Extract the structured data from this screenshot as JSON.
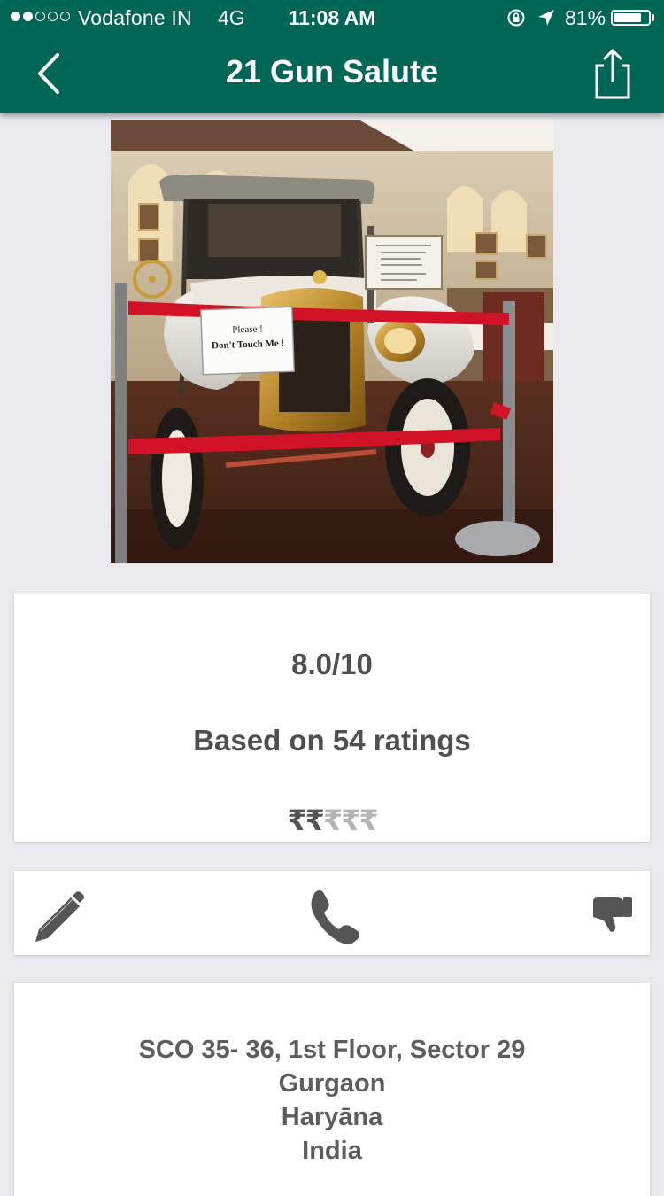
{
  "status_bar": {
    "carrier": "Vodafone IN",
    "network": "4G",
    "time": "11:08 AM",
    "battery_percent": "81%",
    "battery_level": 0.81,
    "signal_bars_filled": 2,
    "signal_bars_total": 5
  },
  "nav": {
    "title": "21 Gun Salute",
    "back_icon": "chevron-left-icon",
    "share_icon": "share-icon"
  },
  "photo": {
    "sign_line1": "Please !",
    "sign_line2": "Don't Touch Me !"
  },
  "rating": {
    "score": "8.0/10",
    "based_on": "Based on 54 ratings",
    "price_active": "₹₹",
    "price_inactive": "₹₹₹",
    "price_level": 2,
    "price_max": 5
  },
  "actions": {
    "edit_icon": "pencil-icon",
    "call_icon": "phone-icon",
    "dislike_icon": "thumbs-down-icon"
  },
  "address": {
    "line1": "SCO 35- 36, 1st Floor, Sector 29",
    "line2": "Gurgaon",
    "line3": "Haryāna",
    "line4": "India"
  },
  "colors": {
    "header": "#006756",
    "background": "#e9e9ee",
    "card": "#ffffff",
    "text": "#4f4f4f",
    "icon": "#555555",
    "price_inactive": "#b4b4b4"
  }
}
